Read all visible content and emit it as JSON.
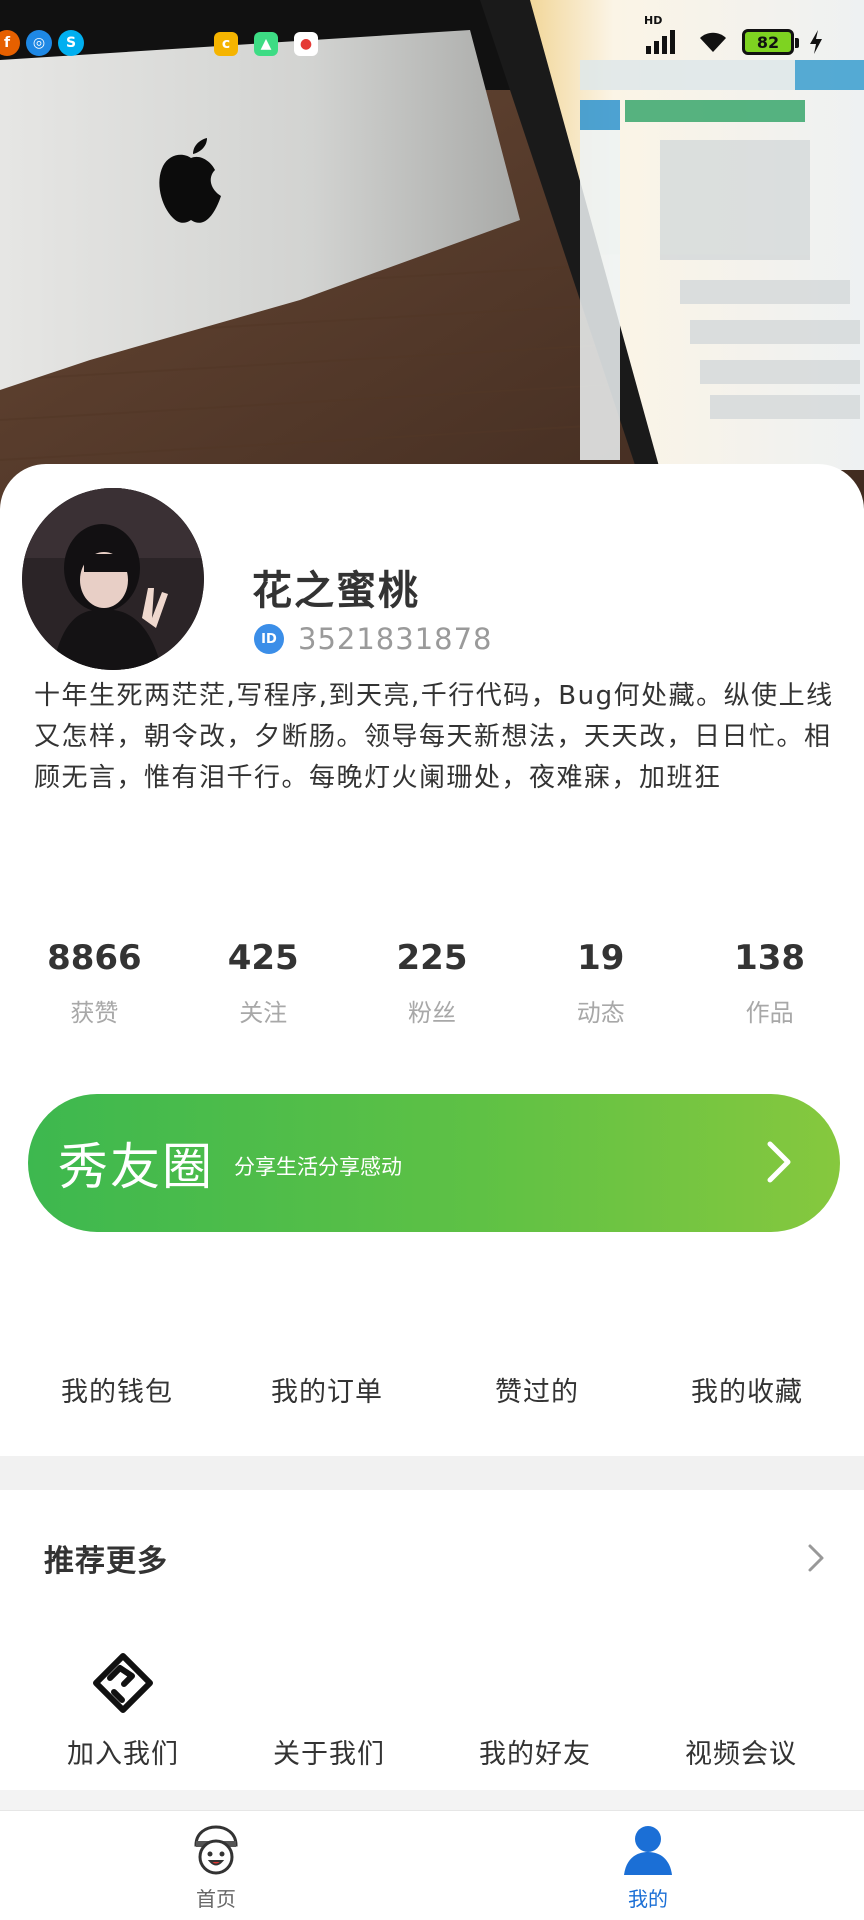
{
  "colors": {
    "accent_blue": "#1b6fd6",
    "id_badge": "#3b8ee8",
    "banner_start": "#3db84f",
    "banner_end": "#86c83e",
    "battery_fill": "#7ed321"
  },
  "status_bar": {
    "battery": "82",
    "network": "HD"
  },
  "profile": {
    "nickname": "花之蜜桃",
    "id_badge": "ID",
    "id_value": "3521831878",
    "bio": "十年生死两茫茫,写程序,到天亮,千行代码，Bug何处藏。纵使上线又怎样，朝令改，夕断肠。领导每天新想法，天天改，日日忙。相顾无言，惟有泪千行。每晚灯火阑珊处，夜难寐，加班狂"
  },
  "stats": [
    {
      "value": "8866",
      "label": "获赞"
    },
    {
      "value": "425",
      "label": "关注"
    },
    {
      "value": "225",
      "label": "粉丝"
    },
    {
      "value": "19",
      "label": "动态"
    },
    {
      "value": "138",
      "label": "作品"
    }
  ],
  "banner": {
    "title": "秀友圈",
    "subtitle": "分享生活分享感动",
    "icon": "chevron-right-icon"
  },
  "shortcuts": [
    {
      "label": "我的钱包"
    },
    {
      "label": "我的订单"
    },
    {
      "label": "赞过的"
    },
    {
      "label": "我的收藏"
    }
  ],
  "recommend": {
    "title": "推荐更多",
    "items": [
      {
        "label": "加入我们",
        "icon": "handshake-icon"
      },
      {
        "label": "关于我们",
        "icon": ""
      },
      {
        "label": "我的好友",
        "icon": ""
      },
      {
        "label": "视频会议",
        "icon": ""
      }
    ]
  },
  "tabbar": {
    "items": [
      {
        "label": "首页",
        "icon": "home-character-icon",
        "active": false
      },
      {
        "label": "我的",
        "icon": "user-icon",
        "active": true
      }
    ]
  }
}
